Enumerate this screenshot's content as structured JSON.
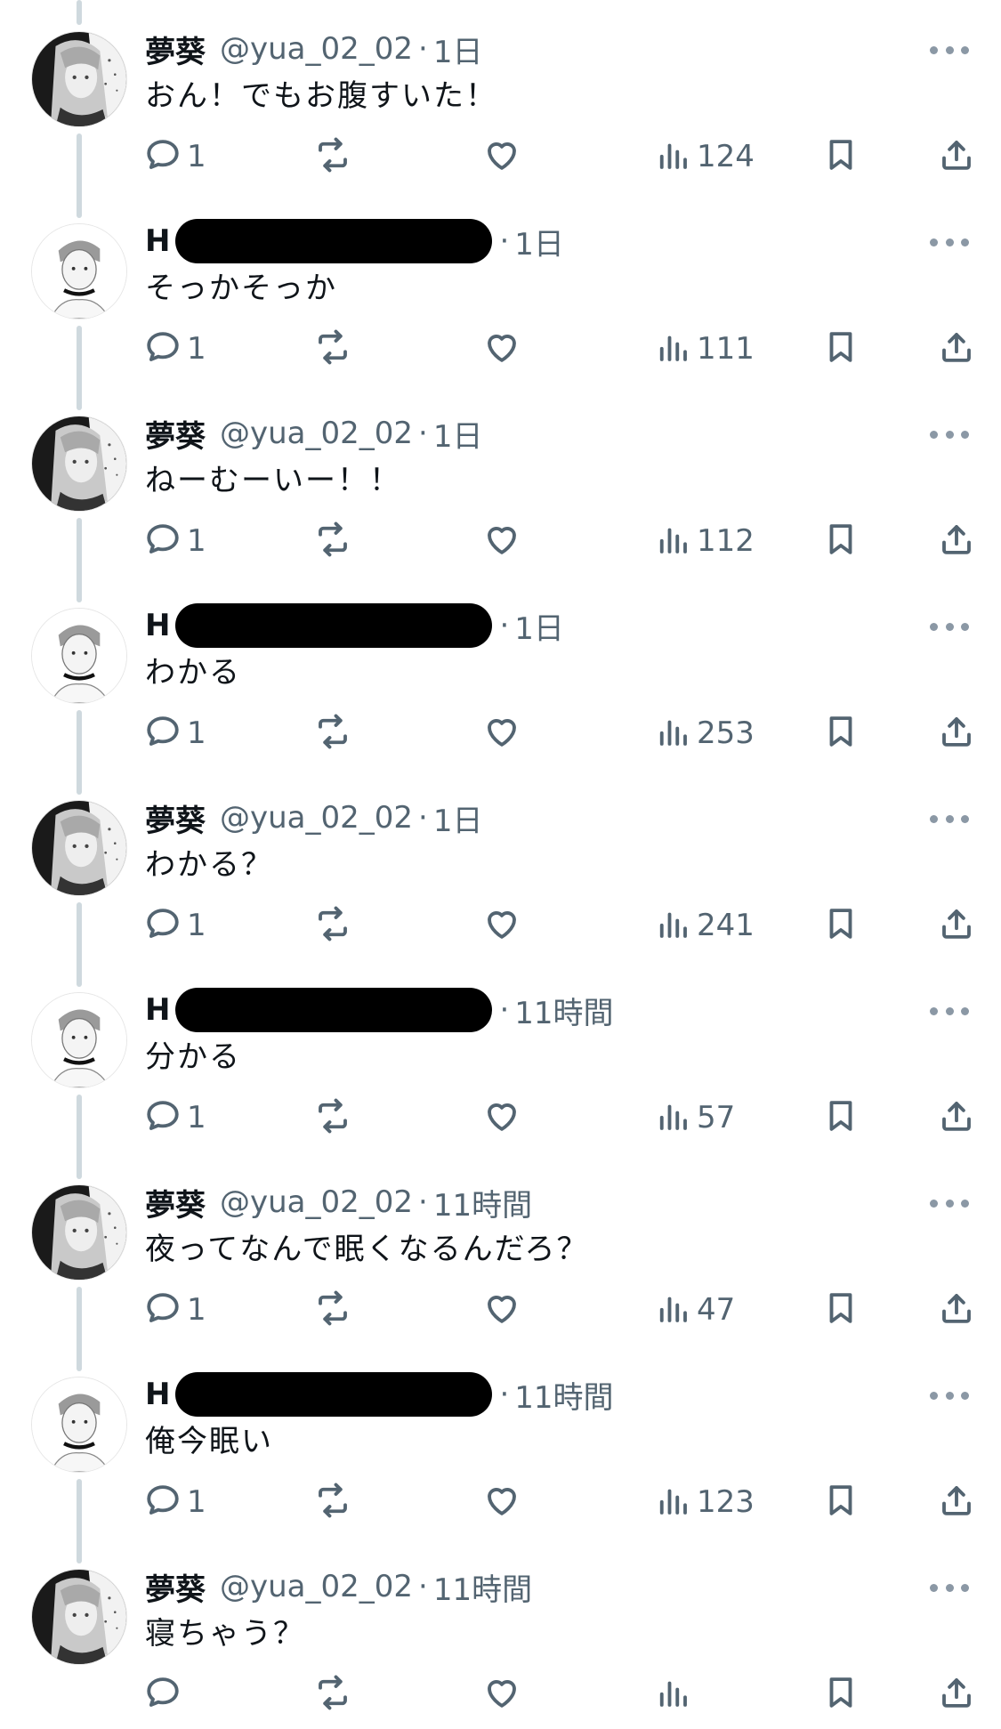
{
  "thread": {
    "tweets": [
      {
        "author": "yua",
        "display_name": "夢葵",
        "handle": "@yua_02_02",
        "time": "1日",
        "text": "おん！でもお腹すいた！",
        "replies": "1",
        "views": "124"
      },
      {
        "author": "h",
        "display_name": "H",
        "handle": "",
        "time": "1日",
        "text": "そっかそっか",
        "replies": "1",
        "views": "111"
      },
      {
        "author": "yua",
        "display_name": "夢葵",
        "handle": "@yua_02_02",
        "time": "1日",
        "text": "ねーむーいー！！",
        "replies": "1",
        "views": "112"
      },
      {
        "author": "h",
        "display_name": "H",
        "handle": "",
        "time": "1日",
        "text": "わかる",
        "replies": "1",
        "views": "253"
      },
      {
        "author": "yua",
        "display_name": "夢葵",
        "handle": "@yua_02_02",
        "time": "1日",
        "text": "わかる？",
        "replies": "1",
        "views": "241"
      },
      {
        "author": "h",
        "display_name": "H",
        "handle": "",
        "time": "11時間",
        "text": "分かる",
        "replies": "1",
        "views": "57"
      },
      {
        "author": "yua",
        "display_name": "夢葵",
        "handle": "@yua_02_02",
        "time": "11時間",
        "text": "夜ってなんで眠くなるんだろ？",
        "replies": "1",
        "views": "47"
      },
      {
        "author": "h",
        "display_name": "H",
        "handle": "",
        "time": "11時間",
        "text": "俺今眠い",
        "replies": "1",
        "views": "123"
      },
      {
        "author": "yua",
        "display_name": "夢葵",
        "handle": "@yua_02_02",
        "time": "11時間",
        "text": "寝ちゃう？",
        "replies": "",
        "views": ""
      }
    ],
    "separator": "·"
  },
  "icons": {
    "reply": "speech-bubble-icon",
    "retweet": "retweet-arrows-icon",
    "like": "heart-icon",
    "views": "bar-chart-icon",
    "bookmark": "bookmark-icon",
    "share": "share-upload-icon",
    "more": "ellipsis-icon"
  },
  "colors": {
    "text": "#0f1419",
    "secondary": "#536471",
    "thread_line": "#cfd9de",
    "redaction": "#000000",
    "background": "#ffffff"
  }
}
